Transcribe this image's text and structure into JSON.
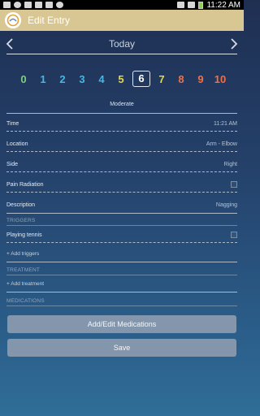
{
  "status_bar": {
    "time": "11:22 AM"
  },
  "action_bar": {
    "title": "Edit Entry"
  },
  "date": {
    "label": "Today"
  },
  "pain_scale": {
    "values": [
      "0",
      "1",
      "2",
      "3",
      "4",
      "5",
      "6",
      "7",
      "8",
      "9",
      "10"
    ],
    "selected": "6",
    "colors": [
      "#7fd07f",
      "#45b7e6",
      "#45b7e6",
      "#45b7e6",
      "#45b7e6",
      "#e8d648",
      "#ffffff",
      "#e8d648",
      "#ef7048",
      "#ef7048",
      "#ef7048"
    ],
    "severity_label": "Moderate"
  },
  "fields": {
    "time": {
      "label": "Time",
      "value": "11:21 AM"
    },
    "location": {
      "label": "Location",
      "value": "Arm - Elbow"
    },
    "side": {
      "label": "Side",
      "value": "Right"
    },
    "pain_radiation": {
      "label": "Pain Radiation"
    },
    "description": {
      "label": "Description",
      "value": "Nagging"
    }
  },
  "triggers": {
    "section_label": "TRIGGERS",
    "items": [
      {
        "label": "Playing tennis"
      }
    ],
    "add_label": "+ Add triggers"
  },
  "treatment": {
    "section_label": "TREATMENT",
    "add_label": "+ Add treatment"
  },
  "medications": {
    "section_label": "MEDICATIONS"
  },
  "buttons": {
    "add_edit_medications": "Add/Edit Medications",
    "save": "Save"
  }
}
